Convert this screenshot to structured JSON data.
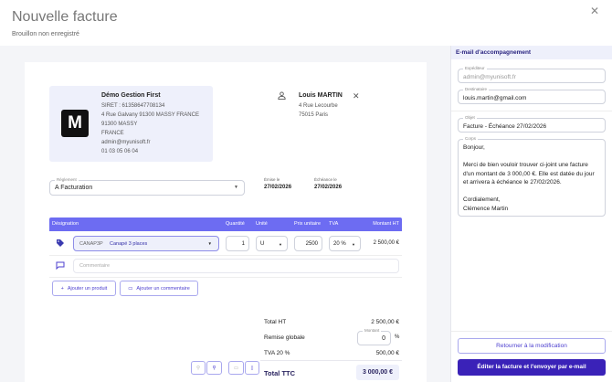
{
  "header": {
    "title": "Nouvelle facture",
    "subtitle": "Brouillon non enregistré",
    "close": "✕"
  },
  "company": {
    "logo": "M",
    "name": "Démo Gestion First",
    "siret": "SIRET : 61358647708134",
    "address": "4 Rue Galvany 91300 MASSY FRANCE",
    "city": "91300 MASSY",
    "country": "FRANCE",
    "email": "admin@myunisoft.fr",
    "phone": "01 03 05 06 04"
  },
  "client": {
    "name": "Louis MARTIN",
    "street": "4 Rue Lecourbe",
    "city": "75015 Paris",
    "remove": "✕"
  },
  "reglement": {
    "label": "Règlement",
    "value": "A Facturation"
  },
  "dates": {
    "issued_label": "Émise le",
    "issued": "27/02/2026",
    "due_label": "Échéance le",
    "due": "27/02/2026"
  },
  "table": {
    "headers": [
      "Désignation",
      "Quantité",
      "Unité",
      "Prix unitaire",
      "TVA",
      "Montant HT"
    ],
    "row": {
      "code": "CANAP3P",
      "product": "Canapé 3 places",
      "qty": "1",
      "unit": "U",
      "price": "2500",
      "tva": "20 %",
      "amount": "2 500,00 €"
    },
    "comment_placeholder": "Commentaire"
  },
  "actions": {
    "add_product": "Ajouter un produit",
    "add_comment": "Ajouter un commentaire"
  },
  "totals": {
    "ht_label": "Total HT",
    "ht": "2 500,00 €",
    "discount_label": "Remise globale",
    "discount_field_label": "Montant",
    "discount": "0",
    "discount_unit": "%",
    "tva_label": "TVA 20 %",
    "tva": "500,00 €",
    "ttc_label": "Total TTC",
    "ttc": "3 000,00 €"
  },
  "email": {
    "title": "E-mail d'accompagnement",
    "from_label": "Expéditeur",
    "from": "admin@myunisoft.fr",
    "to_label": "Destinataire",
    "to": "louis.martin@gmail.com",
    "subject_label": "Objet",
    "subject": "Facture - Échéance 27/02/2026",
    "body_label": "Corps",
    "body": "Bonjour,\n\nMerci de bien vouloir trouver ci-joint une facture d'un montant de 3 000,00 €. Elle est datée du jour et arrivera à échéance le 27/02/2026.\n\nCordialement,\nClémence Martin",
    "back": "Retourner à la modification",
    "send": "Éditer la facture et l'envoyer par e-mail"
  }
}
